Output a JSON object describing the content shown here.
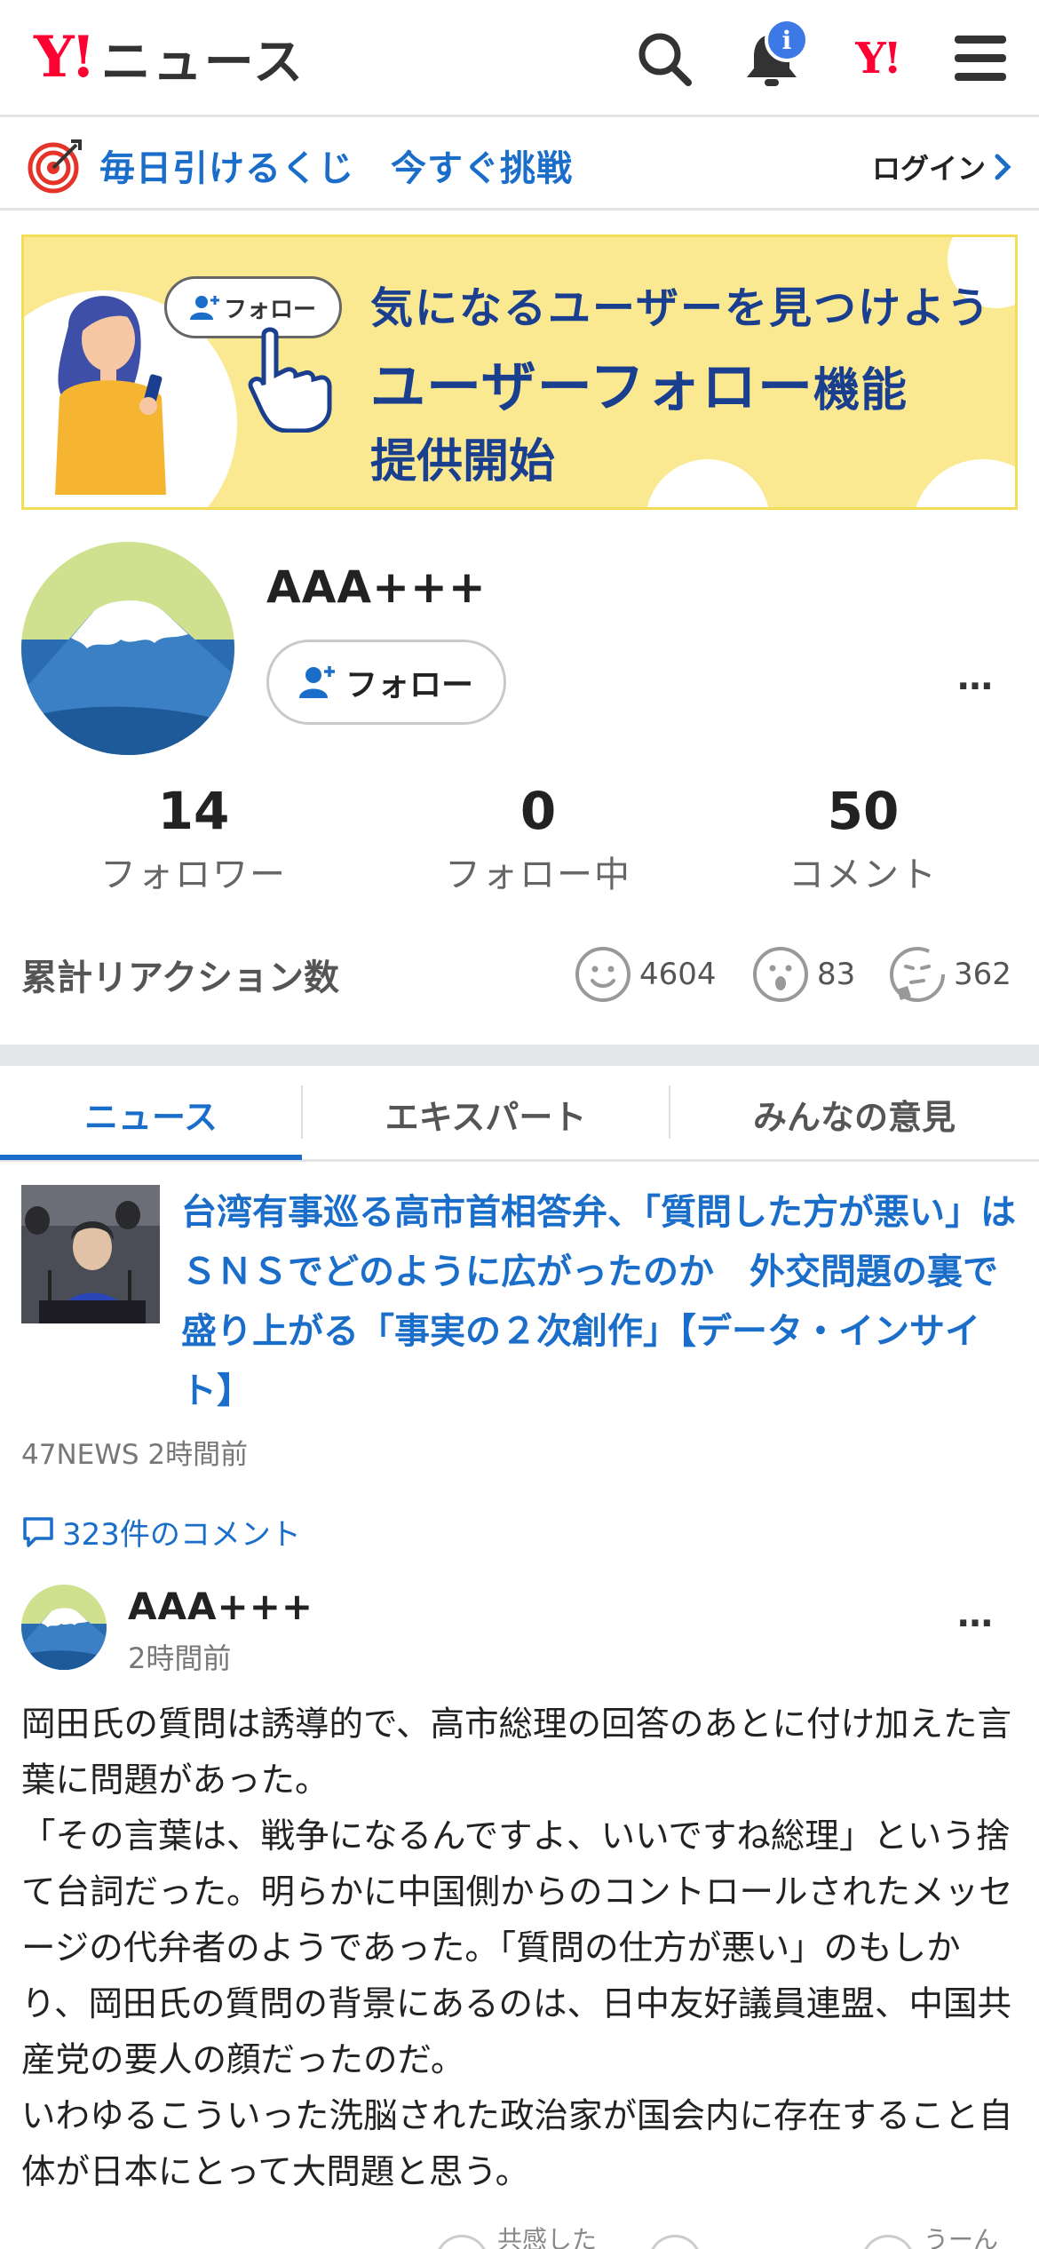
{
  "header": {
    "logo_y": "Y!",
    "logo_text": "ニュース",
    "notification_badge": "i",
    "yj_label": "Y!"
  },
  "lottery": {
    "text": "毎日引けるくじ　今すぐ挑戦",
    "login": "ログイン"
  },
  "banner": {
    "follow_chip": "フォロー",
    "line1": "気になるユーザーを見つけよう",
    "line2_main": "ユーザーフォロー",
    "line2_suffix": "機能",
    "line3": "提供開始"
  },
  "profile": {
    "username": "AAA+++",
    "follow_button": "フォロー",
    "more": "…",
    "stats": [
      {
        "value": "14",
        "label": "フォロワー"
      },
      {
        "value": "0",
        "label": "フォロー中"
      },
      {
        "value": "50",
        "label": "コメント"
      }
    ],
    "reactions_title": "累計リアクション数",
    "reactions": [
      {
        "icon": "smile-icon",
        "count": "4604"
      },
      {
        "icon": "surprised-icon",
        "count": "83"
      },
      {
        "icon": "thinking-icon",
        "count": "362"
      }
    ]
  },
  "tabs": [
    {
      "label": "ニュース",
      "active": true
    },
    {
      "label": "エキスパート",
      "active": false
    },
    {
      "label": "みんなの意見",
      "active": false
    }
  ],
  "article": {
    "title": "台湾有事巡る高市首相答弁、「質問した方が悪い」はＳＮＳでどのように広がったのか　外交問題の裏で盛り上がる「事実の２次創作」【データ・インサイト】",
    "source_time": "47NEWS 2時間前",
    "comments_link": "323件のコメント"
  },
  "comment": {
    "user": "AAA+++",
    "time": "2時間前",
    "more": "…",
    "body": "岡田氏の質問は誘導的で、高市総理の回答のあとに付け加えた言葉に問題があった。\n「その言葉は、戦争になるんですよ、いいですね総理」という捨て台詞だった。明らかに中国側からのコントロールされたメッセージの代弁者のようであった。「質問の仕方が悪い」のもしかり、岡田氏の質問の背景にあるのは、日中友好議員連盟、中国共産党の要人の顔だったのだ。\nいわゆるこういった洗脳された政治家が国会内に存在すること自体が日本にとって大問題と思う。",
    "footer_left": "共感した",
    "footer_right": "うーん"
  },
  "colors": {
    "accent_blue": "#1a6ec9",
    "brand_red": "#ff0033",
    "banner_yellow": "#fbe992",
    "banner_navy": "#1a3f8f"
  }
}
